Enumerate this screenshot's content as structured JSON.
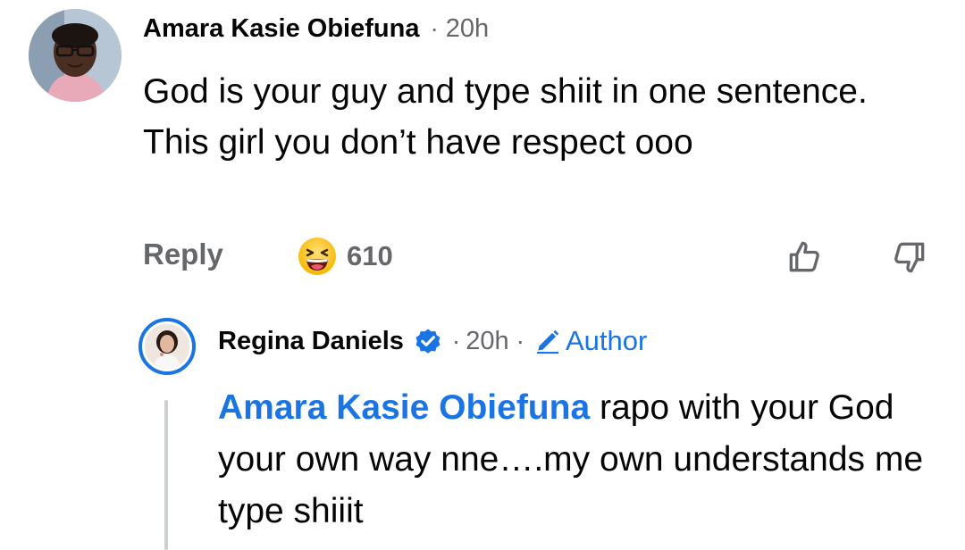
{
  "comment": {
    "author": "Amara Kasie Obiefuna",
    "separator": "·",
    "time": "20h",
    "text": "God is your guy and type shiit in one sentence. This girl you don’t have respect ooo",
    "reply_label": "Reply",
    "reaction_icon": "laughing-face-icon",
    "reaction_count": "610"
  },
  "reply": {
    "author": "Regina Daniels",
    "verified_icon": "verified-badge-icon",
    "separator": "·",
    "time": "20h",
    "separator2": "·",
    "badge_label": "Author",
    "mention": "Amara Kasie Obiefuna",
    "text": " rapo with your God your own way nne….my own understands me type shiiit"
  },
  "colors": {
    "accent": "#1b74e4",
    "secondary_text": "#65676b",
    "primary_text": "#050505",
    "thread_line": "#ccd0d5"
  }
}
